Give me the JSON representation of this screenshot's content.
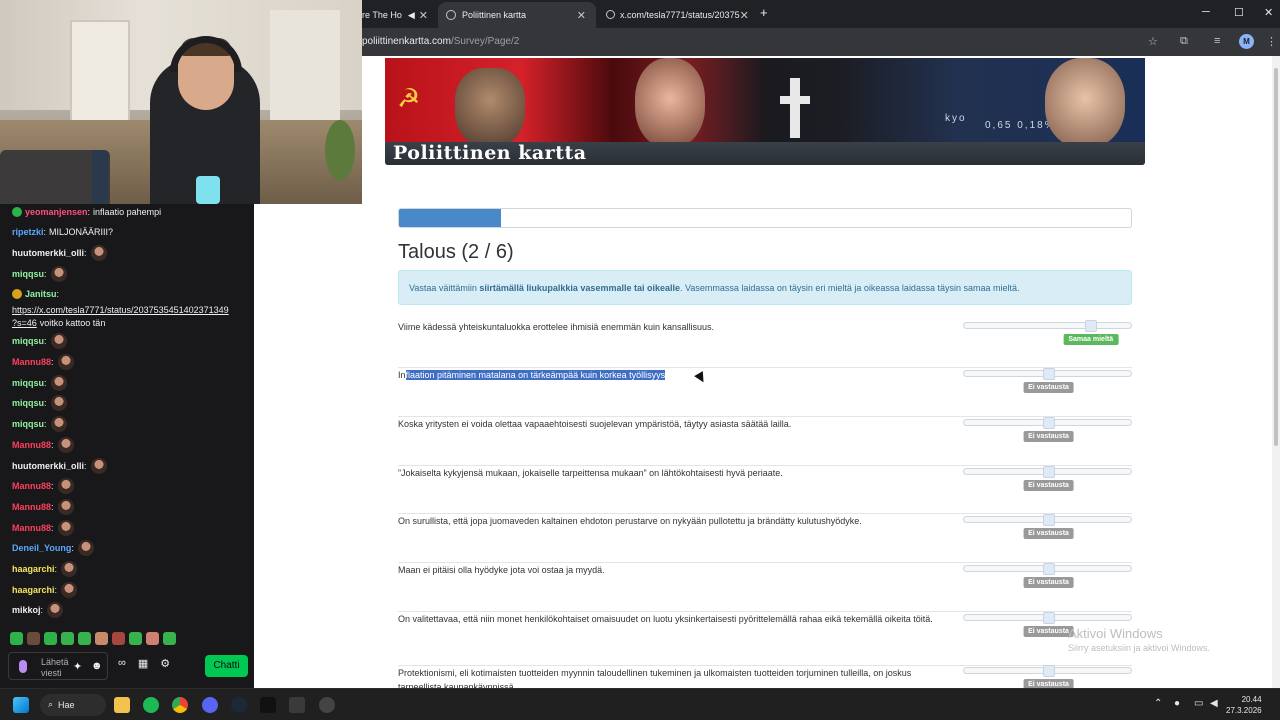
{
  "chat": {
    "messages": [
      {
        "user": "yeomanjensen",
        "color": "#ff4f7a",
        "text": "inflaatio pahempi",
        "emote": false
      },
      {
        "user": "ripetzki",
        "color": "#5aa9ff",
        "text": "MILJONÄÄRIII?",
        "emote": false
      },
      {
        "user": "huutomerkki_olli",
        "color": "#efeff1",
        "text": "",
        "emote": true
      },
      {
        "user": "miqqsu",
        "color": "#8ef1a0",
        "text": "",
        "emote": true
      },
      {
        "user": "Janitsu",
        "color": "#8ef1a0",
        "text": "",
        "emote": false
      },
      {
        "user": "miqqsu",
        "color": "#8ef1a0",
        "text": "",
        "emote": true
      },
      {
        "user": "Mannu88",
        "color": "#ff3f5e",
        "text": "",
        "emote": true
      },
      {
        "user": "miqqsu",
        "color": "#8ef1a0",
        "text": "",
        "emote": true
      },
      {
        "user": "miqqsu",
        "color": "#8ef1a0",
        "text": "",
        "emote": true
      },
      {
        "user": "miqqsu",
        "color": "#8ef1a0",
        "text": "",
        "emote": true
      },
      {
        "user": "Mannu88",
        "color": "#ff3f5e",
        "text": "",
        "emote": true
      },
      {
        "user": "huutomerkki_olli",
        "color": "#efeff1",
        "text": "",
        "emote": true
      },
      {
        "user": "Mannu88",
        "color": "#ff3f5e",
        "text": "",
        "emote": true
      },
      {
        "user": "Mannu88",
        "color": "#ff3f5e",
        "text": "",
        "emote": true
      },
      {
        "user": "Mannu88",
        "color": "#ff3f5e",
        "text": "",
        "emote": true
      },
      {
        "user": "Deneil_Young",
        "color": "#5aa9ff",
        "text": "",
        "emote": true
      },
      {
        "user": "haagarchi",
        "color": "#f4e35b",
        "text": "",
        "emote": true
      },
      {
        "user": "haagarchi",
        "color": "#f4e35b",
        "text": "",
        "emote": true
      },
      {
        "user": "mikkoj",
        "color": "#efeff1",
        "text": "",
        "emote": true
      }
    ],
    "link_line1": "https://x.com/tesla7771/status/2037535451402371349",
    "link_line2": "?s=46",
    "link_after": "voitko kattoo tän",
    "input_placeholder": "Lähetä viesti",
    "send_label": "Chatti"
  },
  "browser": {
    "tab1_title": "re The Ho",
    "tab2_title": "Poliittinen kartta",
    "tab3_title": "x.com/tesla7771/status/20375",
    "url_host": "poliittinenkartta.com",
    "url_path": "/Survey/Page/2",
    "avatar_letter": "M"
  },
  "page": {
    "banner_title": "Poliittinen kartta",
    "banner_stats": "0,65   0,18%",
    "banner_word": "kyo",
    "progress_fraction": 0.14,
    "heading": "Talous (2 / 6)",
    "alert_pre": "Vastaa väittämiin ",
    "alert_bold": "siirtämällä liukupalkkia vasemmalle tai oikealle",
    "alert_post": ". Vasemmassa laidassa on täysin eri mieltä ja oikeassa laidassa täysin samaa mieltä.",
    "questions": [
      {
        "text": "Viime kädessä yhteiskuntaluokka erottelee ihmisiä enemmän kuin kansallisuus.",
        "answer": "Samaa mieltä",
        "answer_color": "#5cb85c",
        "value": 0.75
      },
      {
        "text_pre": "In",
        "text_sel": "flaation pitäminen matalana on tärkeämpää kuin korkea työllisyys",
        "answer": "Ei vastausta",
        "answer_color": "#999999",
        "value": 0.5
      },
      {
        "text": "Koska yritysten ei voida olettaa vapaaehtoisesti suojelevan ympäristöä, täytyy asiasta säätää lailla.",
        "answer": "Ei vastausta",
        "answer_color": "#999999",
        "value": 0.5
      },
      {
        "text": "”Jokaiselta kykyjensä mukaan, jokaiselle tarpeittensa mukaan” on lähtökohtaisesti hyvä periaate.",
        "answer": "Ei vastausta",
        "answer_color": "#999999",
        "value": 0.5
      },
      {
        "text": "On surullista, että jopa juomaveden kaltainen ehdoton perustarve on nykyään pullotettu ja brändätty kulutushyödyke.",
        "answer": "Ei vastausta",
        "answer_color": "#999999",
        "value": 0.5
      },
      {
        "text": "Maan ei pitäisi olla hyödyke jota voi ostaa ja myydä.",
        "answer": "Ei vastausta",
        "answer_color": "#999999",
        "value": 0.5
      },
      {
        "text": "On valitettavaa, että niin monet henkilökohtaiset omaisuudet on luotu yksinkertaisesti pyörittelemällä rahaa eikä tekemällä oikeita töitä.",
        "answer": "Ei vastausta",
        "answer_color": "#999999",
        "value": 0.5
      },
      {
        "text": "Protektionismi, eli kotimaisten tuotteiden myynnin taloudellinen tukeminen ja ulkomaisten tuotteiden torjuminen tulleilla, on joskus tarpeellista kaupankäynnissä.",
        "answer": "Ei vastausta",
        "answer_color": "#999999",
        "value": 0.5
      }
    ]
  },
  "watermark": {
    "title": "Aktivoi Windows",
    "sub": "Siirry asetuksiin ja aktivoi Windows."
  },
  "taskbar": {
    "search_label": "Hae",
    "time": "20.44",
    "date": "27.3.2026"
  }
}
